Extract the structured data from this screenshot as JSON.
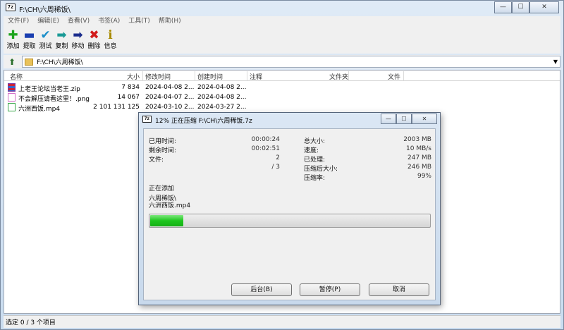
{
  "window": {
    "title": "F:\\CH\\六周稀饭\\",
    "app_icon_text": "7z",
    "caption": {
      "minimize": "—",
      "maximize": "☐",
      "close": "✕"
    }
  },
  "menu": [
    "文件(F)",
    "编辑(E)",
    "查看(V)",
    "书签(A)",
    "工具(T)",
    "帮助(H)"
  ],
  "toolbar": [
    {
      "label": "添加",
      "icon": "plus-icon",
      "glyph": "✚",
      "color": "#1fa51f"
    },
    {
      "label": "提取",
      "icon": "minus-icon",
      "glyph": "▬",
      "color": "#1b3fb0"
    },
    {
      "label": "测试",
      "icon": "check-icon",
      "glyph": "✔",
      "color": "#1c8fc9"
    },
    {
      "label": "复制",
      "icon": "copy-arrow-icon",
      "glyph": "➡",
      "color": "#1a9a96"
    },
    {
      "label": "移动",
      "icon": "move-arrow-icon",
      "glyph": "➡",
      "color": "#1b2d8c"
    },
    {
      "label": "删除",
      "icon": "delete-x-icon",
      "glyph": "✖",
      "color": "#d11a1a"
    },
    {
      "label": "信息",
      "icon": "info-icon",
      "glyph": "ℹ",
      "color": "#a88a00"
    }
  ],
  "address": {
    "path": "F:\\CH\\六周稀饭\\"
  },
  "columns": [
    "名称",
    "大小",
    "修改时间",
    "创建时间",
    "注释",
    "文件夹",
    "文件"
  ],
  "files": [
    {
      "name": "上老王论坛当老王.zip",
      "size": "7 834",
      "modified": "2024-04-08 2...",
      "created": "2024-04-08 2...",
      "icon": "zip-file-icon"
    },
    {
      "name": "不会解压请看这里！.png",
      "size": "14 067",
      "modified": "2024-04-07 2...",
      "created": "2024-04-08 2...",
      "icon": "image-file-icon"
    },
    {
      "name": "六洲西饭.mp4",
      "size": "2 101 131 125",
      "modified": "2024-03-10 2...",
      "created": "2024-03-27 2...",
      "icon": "video-file-icon"
    }
  ],
  "status": {
    "text": "选定 0 / 3 个项目"
  },
  "dialog": {
    "title": "12% 正在压缩 F:\\CH\\六周稀饭.7z",
    "elapsed_label": "已用时间:",
    "elapsed": "00:00:24",
    "remaining_label": "剩余时间:",
    "remaining": "00:02:51",
    "files_label": "文件:",
    "files": "2",
    "files_total": "/ 3",
    "total_size_label": "总大小:",
    "total_size": "2003 MB",
    "speed_label": "速度:",
    "speed": "10 MB/s",
    "processed_label": "已处理:",
    "processed": "247 MB",
    "compressed_size_label": "压缩后大小:",
    "compressed_size": "246 MB",
    "ratio_label": "压缩率:",
    "ratio": "99%",
    "adding_label": "正在添加",
    "current_folder": "六周稀饭\\",
    "current_file": "六洲西饭.mp4",
    "progress": 0.12,
    "buttons": {
      "background": "后台(B)",
      "pause": "暂停(P)",
      "cancel": "取消"
    }
  }
}
